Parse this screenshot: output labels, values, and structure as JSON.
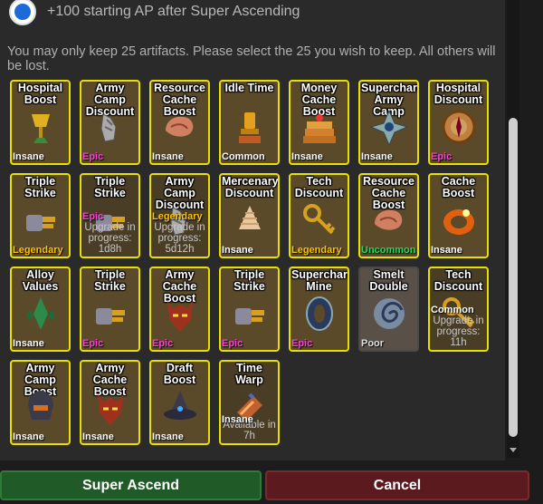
{
  "option": {
    "label": "+100 starting AP after Super Ascending",
    "selected": true
  },
  "instructions": "You may only keep 25 artifacts.  Please select the 25 you wish to keep.  All others will be lost.",
  "artifacts": [
    {
      "name": "Hospital Boost",
      "rarity": "Insane",
      "status": "",
      "icon": "golden-chalice-icon"
    },
    {
      "name": "Army Camp Discount",
      "rarity": "Epic",
      "status": "",
      "icon": "stone-claw-icon"
    },
    {
      "name": "Resource Cache Boost",
      "rarity": "Insane",
      "status": "",
      "icon": "shell-icon"
    },
    {
      "name": "Idle Time",
      "rarity": "Common",
      "status": "",
      "icon": "golden-trophy-icon"
    },
    {
      "name": "Money Cache Boost",
      "rarity": "Insane",
      "status": "",
      "icon": "cake-icon"
    },
    {
      "name": "Supercharge Army Camp",
      "rarity": "Insane",
      "status": "",
      "icon": "shuriken-icon"
    },
    {
      "name": "Hospital Discount",
      "rarity": "Epic",
      "status": "",
      "icon": "compass-icon"
    },
    {
      "name": "Triple Strike",
      "rarity": "Legendary",
      "status": "",
      "icon": "gauntlet-icon"
    },
    {
      "name": "Triple Strike",
      "rarity": "Epic",
      "status": "Upgrade in progress: 1d8h",
      "icon": "gauntlet-icon"
    },
    {
      "name": "Army Camp Discount",
      "rarity": "Legendary",
      "status": "Upgrade in progress: 5d12h",
      "icon": "stone-claw-icon"
    },
    {
      "name": "Mercenary Discount",
      "rarity": "Insane",
      "status": "",
      "icon": "cream-swirl-icon"
    },
    {
      "name": "Tech Discount",
      "rarity": "Legendary",
      "status": "",
      "icon": "key-icon"
    },
    {
      "name": "Resource Cache Boost",
      "rarity": "Uncommon",
      "status": "",
      "icon": "shell-icon"
    },
    {
      "name": "Cache Boost",
      "rarity": "Insane",
      "status": "",
      "icon": "ring-icon"
    },
    {
      "name": "Alloy Values",
      "rarity": "Insane",
      "status": "",
      "icon": "green-crystal-icon"
    },
    {
      "name": "Triple Strike",
      "rarity": "Epic",
      "status": "",
      "icon": "gauntlet-icon"
    },
    {
      "name": "Army Cache Boost",
      "rarity": "Epic",
      "status": "",
      "icon": "demon-mask-icon"
    },
    {
      "name": "Triple Strike",
      "rarity": "Epic",
      "status": "",
      "icon": "gauntlet-icon"
    },
    {
      "name": "Supercharge Mine",
      "rarity": "Epic",
      "status": "",
      "icon": "shield-ring-icon"
    },
    {
      "name": "Smelt Double",
      "rarity": "Poor",
      "status": "",
      "icon": "swirl-icon"
    },
    {
      "name": "Tech Discount",
      "rarity": "Common",
      "status": "Upgrade in progress: 11h",
      "icon": "key-icon"
    },
    {
      "name": "Army Camp Boost",
      "rarity": "Insane",
      "status": "",
      "icon": "helmet-icon"
    },
    {
      "name": "Army Cache Boost",
      "rarity": "Insane",
      "status": "",
      "icon": "demon-mask-icon"
    },
    {
      "name": "Draft Boost",
      "rarity": "Insane",
      "status": "",
      "icon": "wizard-hat-icon"
    },
    {
      "name": "Time Warp",
      "rarity": "Insane",
      "status": "Available in 7h",
      "icon": "hourglass-icon"
    }
  ],
  "buttons": {
    "ascend": "Super Ascend",
    "cancel": "Cancel"
  },
  "colors": {
    "card_border": "#e8e000",
    "card_bg": "#5a4a2a",
    "ascend_bg": "#1f5a27",
    "cancel_bg": "#5a1a1e",
    "radio": "#1a6bd8"
  }
}
